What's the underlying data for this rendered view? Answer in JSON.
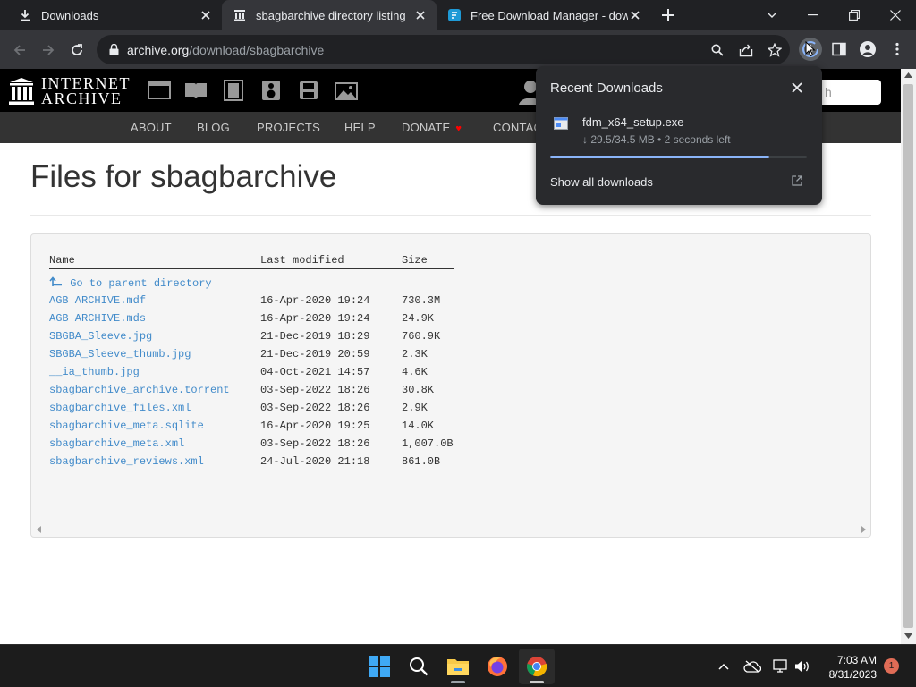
{
  "tabs": [
    {
      "title": "Downloads",
      "icon": "download-icon",
      "active": false
    },
    {
      "title": "sbagbarchive directory listing",
      "icon": "internet-archive-icon",
      "active": true
    },
    {
      "title": "Free Download Manager - downl",
      "icon": "fdm-icon",
      "active": false
    }
  ],
  "omnibox": {
    "url_host": "archive.org",
    "url_path": "/download/sbagbarchive"
  },
  "ia": {
    "logo_line1": "INTERNET",
    "logo_line2": "ARCHIVE",
    "search_placeholder": "h",
    "media_icons": [
      "web-icon",
      "texts-icon",
      "video-icon",
      "audio-icon",
      "software-icon",
      "images-icon"
    ],
    "nav": [
      "ABOUT",
      "BLOG",
      "PROJECTS",
      "HELP",
      "DONATE",
      "CONTAC"
    ]
  },
  "page": {
    "title": "Files for sbagbarchive",
    "columns": {
      "name": "Name",
      "modified": "Last modified",
      "size": "Size"
    },
    "parent_link": "Go to parent directory",
    "files": [
      {
        "name": "AGB ARCHIVE.mdf",
        "modified": "16-Apr-2020 19:24",
        "size": "730.3M"
      },
      {
        "name": "AGB ARCHIVE.mds",
        "modified": "16-Apr-2020 19:24",
        "size": "24.9K"
      },
      {
        "name": "SBGBA_Sleeve.jpg",
        "modified": "21-Dec-2019 18:29",
        "size": "760.9K"
      },
      {
        "name": "SBGBA_Sleeve_thumb.jpg",
        "modified": "21-Dec-2019 20:59",
        "size": "2.3K"
      },
      {
        "name": "__ia_thumb.jpg",
        "modified": "04-Oct-2021 14:57",
        "size": "4.6K"
      },
      {
        "name": "sbagbarchive_archive.torrent",
        "modified": "03-Sep-2022 18:26",
        "size": "30.8K"
      },
      {
        "name": "sbagbarchive_files.xml",
        "modified": "03-Sep-2022 18:26",
        "size": "2.9K"
      },
      {
        "name": "sbagbarchive_meta.sqlite",
        "modified": "16-Apr-2020 19:25",
        "size": "14.0K"
      },
      {
        "name": "sbagbarchive_meta.xml",
        "modified": "03-Sep-2022 18:26",
        "size": "1,007.0B"
      },
      {
        "name": "sbagbarchive_reviews.xml",
        "modified": "24-Jul-2020 21:18",
        "size": "861.0B"
      }
    ]
  },
  "download": {
    "heading": "Recent Downloads",
    "filename": "fdm_x64_setup.exe",
    "status": "↓ 29.5/34.5 MB • 2 seconds left",
    "progress": 0.855,
    "show_all": "Show all downloads"
  },
  "taskbar": {
    "apps": [
      "windows-start-icon",
      "search-icon",
      "file-explorer-icon",
      "firefox-icon",
      "chrome-icon"
    ],
    "time": "7:03 AM",
    "date": "8/31/2023",
    "notifications": "1"
  },
  "colors": {
    "accent": "#8ab4f8",
    "link": "#428bca",
    "ia_black": "#000000",
    "ia_nav": "#333333"
  }
}
